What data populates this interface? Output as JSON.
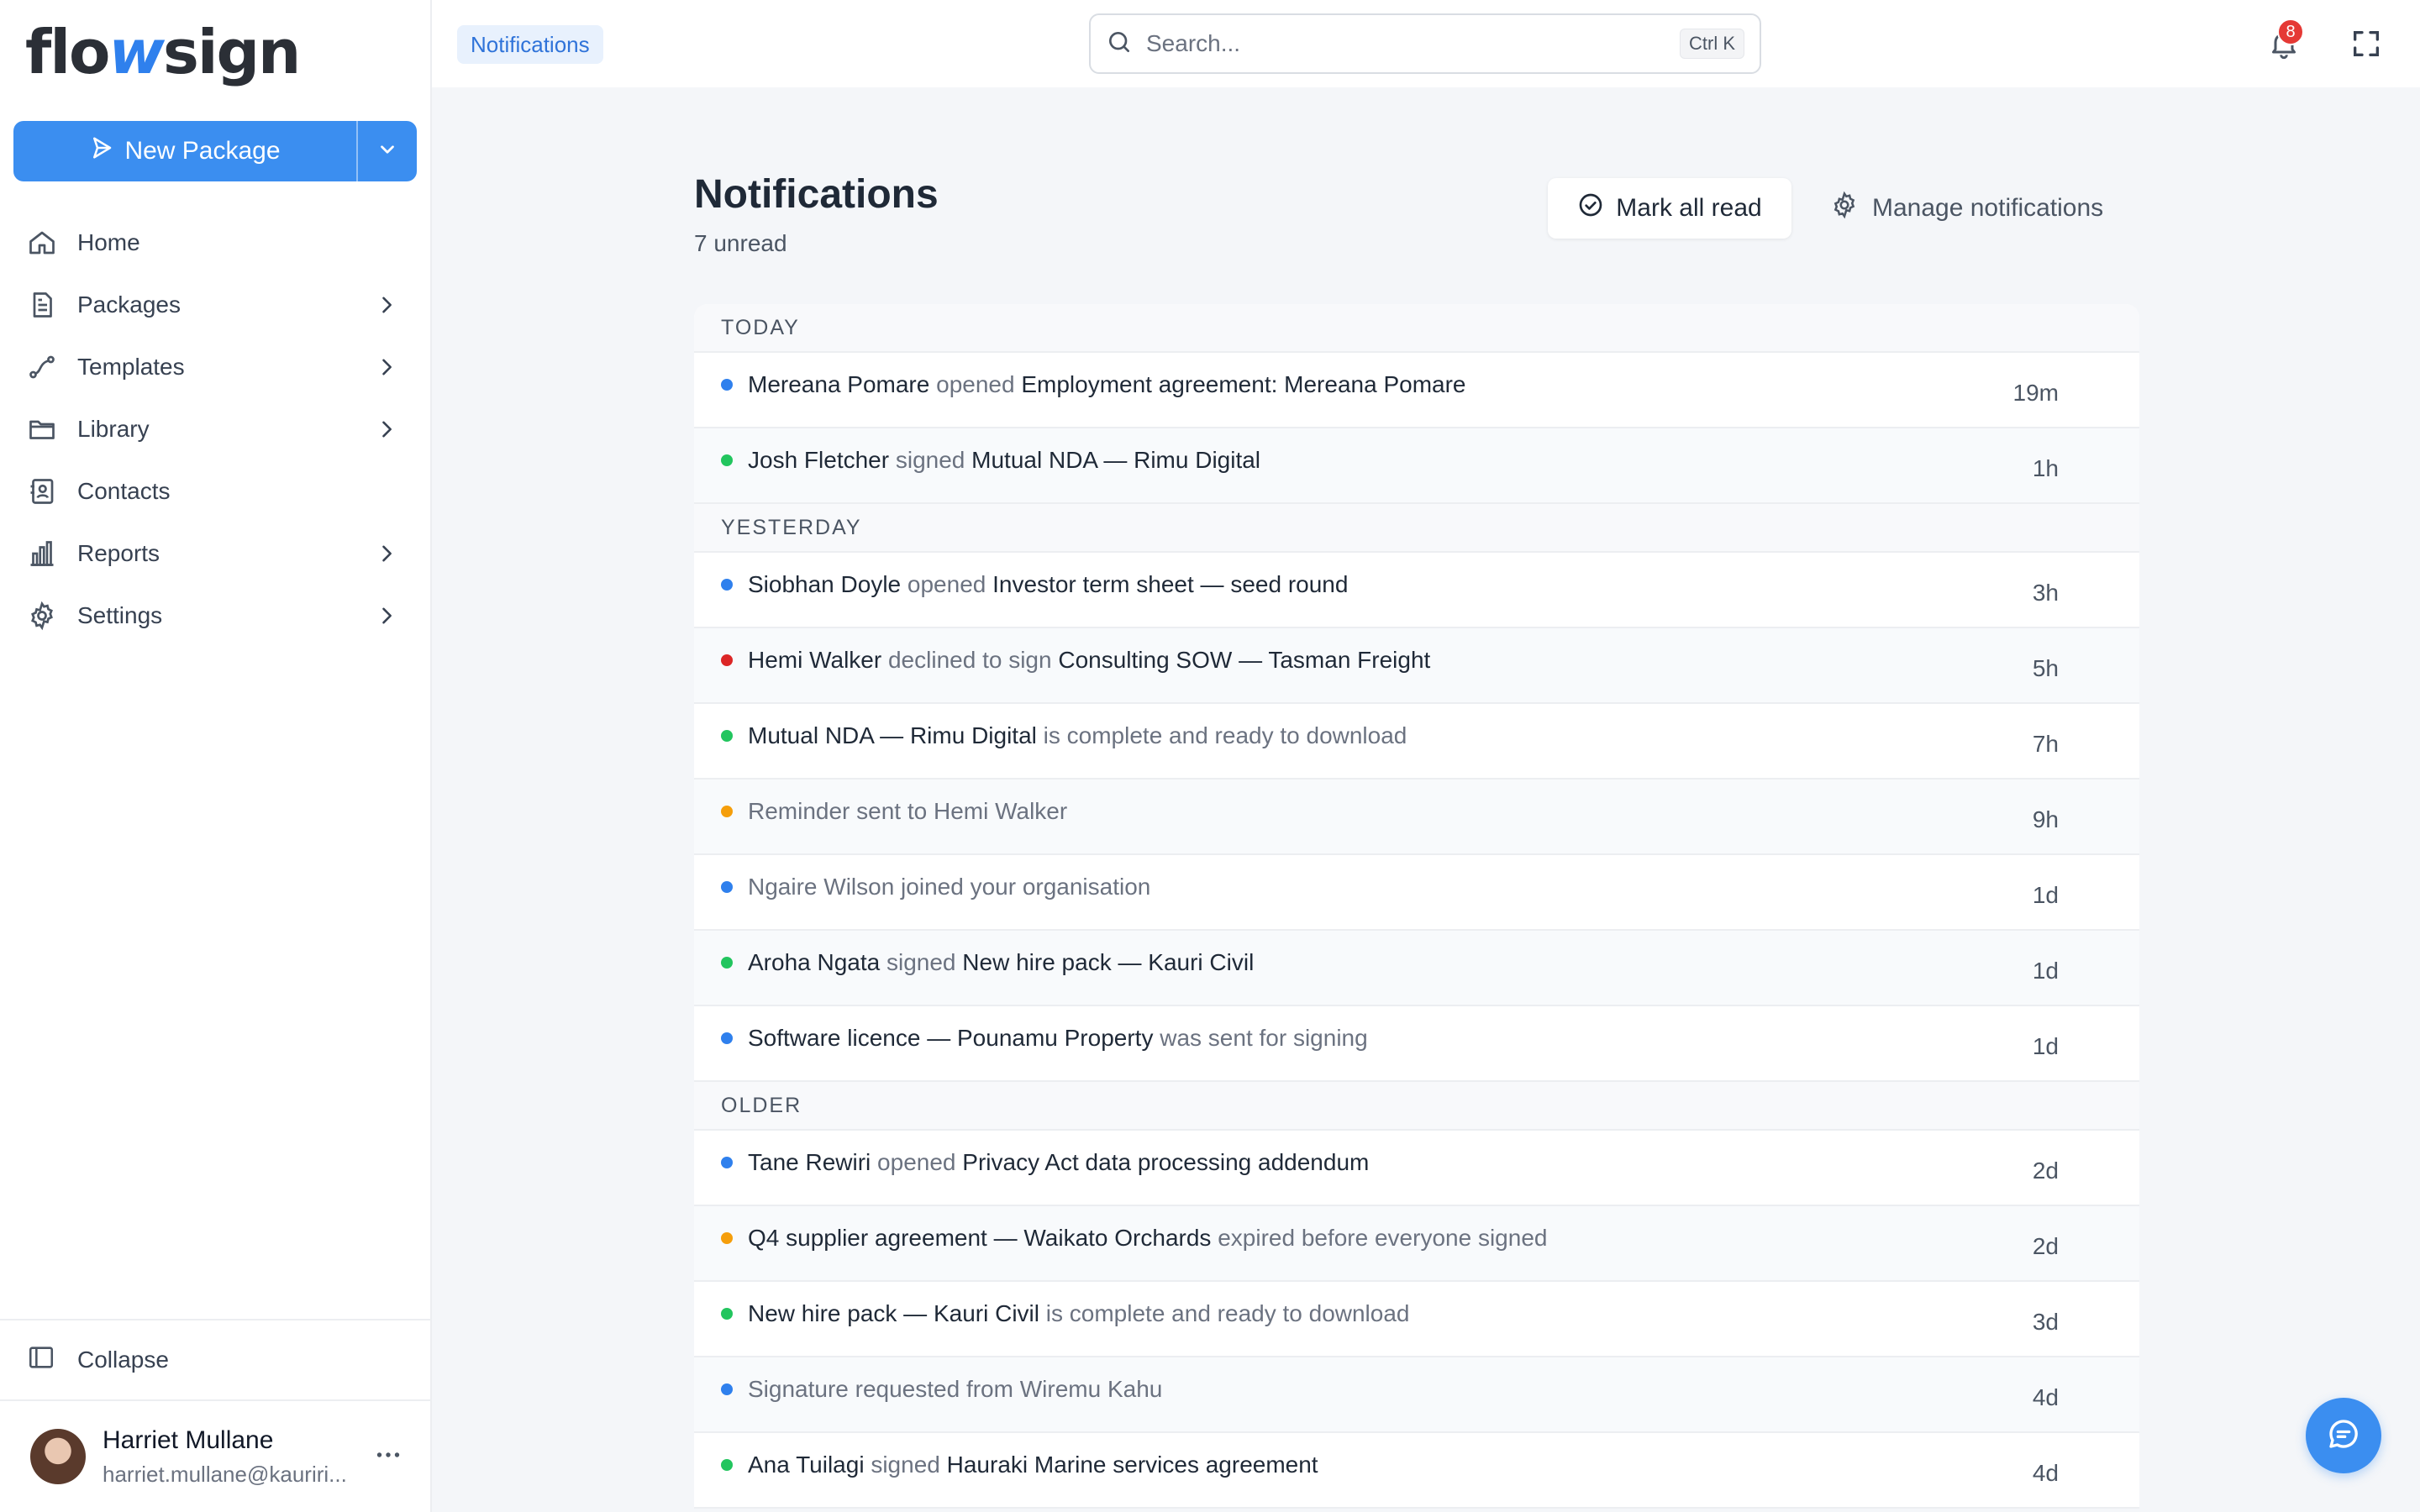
{
  "brand": {
    "logo_pre": "flo",
    "logo_accent": "w",
    "logo_post": "sign"
  },
  "sidebar": {
    "new_package_label": "New Package",
    "items": [
      {
        "label": "Home",
        "icon": "home-icon",
        "chevron": false
      },
      {
        "label": "Packages",
        "icon": "document-icon",
        "chevron": true
      },
      {
        "label": "Templates",
        "icon": "route-icon",
        "chevron": true
      },
      {
        "label": "Library",
        "icon": "folder-icon",
        "chevron": true
      },
      {
        "label": "Contacts",
        "icon": "contacts-icon",
        "chevron": false
      },
      {
        "label": "Reports",
        "icon": "bar-chart-icon",
        "chevron": true
      },
      {
        "label": "Settings",
        "icon": "gear-icon",
        "chevron": true
      }
    ],
    "collapse_label": "Collapse",
    "user": {
      "name": "Harriet Mullane",
      "email": "harriet.mullane@kauriri..."
    }
  },
  "topbar": {
    "breadcrumb": "Notifications",
    "search_placeholder": "Search...",
    "search_shortcut": "Ctrl K",
    "notification_count": "8"
  },
  "page": {
    "title": "Notifications",
    "unread_text": "7 unread",
    "mark_all_read": "Mark all read",
    "manage_notifications": "Manage notifications"
  },
  "colors": {
    "blue": "#2f80ed",
    "green": "#22c55e",
    "red": "#dc2626",
    "orange": "#f59e0b"
  },
  "groups": [
    {
      "label": "TODAY",
      "items": [
        {
          "dot": "blue",
          "parts": [
            [
              "Mereana Pomare",
              "s"
            ],
            [
              " opened ",
              "m"
            ],
            [
              "Employment agreement: Mereana Pomare",
              "s"
            ]
          ],
          "time": "19m"
        },
        {
          "dot": "green",
          "parts": [
            [
              "Josh Fletcher",
              "s"
            ],
            [
              " signed ",
              "m"
            ],
            [
              "Mutual NDA — Rimu Digital",
              "s"
            ]
          ],
          "time": "1h"
        }
      ]
    },
    {
      "label": "YESTERDAY",
      "items": [
        {
          "dot": "blue",
          "parts": [
            [
              "Siobhan Doyle",
              "s"
            ],
            [
              " opened ",
              "m"
            ],
            [
              "Investor term sheet — seed round",
              "s"
            ]
          ],
          "time": "3h"
        },
        {
          "dot": "red",
          "parts": [
            [
              "Hemi Walker",
              "s"
            ],
            [
              " declined to sign ",
              "m"
            ],
            [
              "Consulting SOW — Tasman Freight",
              "s"
            ]
          ],
          "time": "5h"
        },
        {
          "dot": "green",
          "parts": [
            [
              "Mutual NDA — Rimu Digital",
              "s"
            ],
            [
              " is complete and ready to download",
              "m"
            ]
          ],
          "time": "7h"
        },
        {
          "dot": "orange",
          "parts": [
            [
              "Reminder sent to Hemi Walker",
              "m"
            ]
          ],
          "time": "9h"
        },
        {
          "dot": "blue",
          "parts": [
            [
              "Ngaire Wilson joined your organisation",
              "m"
            ]
          ],
          "time": "1d"
        },
        {
          "dot": "green",
          "parts": [
            [
              "Aroha Ngata",
              "s"
            ],
            [
              " signed ",
              "m"
            ],
            [
              "New hire pack — Kauri Civil",
              "s"
            ]
          ],
          "time": "1d"
        },
        {
          "dot": "blue",
          "parts": [
            [
              "Software licence — Pounamu Property",
              "s"
            ],
            [
              " was sent for signing",
              "m"
            ]
          ],
          "time": "1d"
        }
      ]
    },
    {
      "label": "OLDER",
      "items": [
        {
          "dot": "blue",
          "parts": [
            [
              "Tane Rewiri",
              "s"
            ],
            [
              " opened ",
              "m"
            ],
            [
              "Privacy Act data processing addendum",
              "s"
            ]
          ],
          "time": "2d"
        },
        {
          "dot": "orange",
          "parts": [
            [
              "Q4 supplier agreement — Waikato Orchards",
              "s"
            ],
            [
              " expired before everyone signed",
              "m"
            ]
          ],
          "time": "2d"
        },
        {
          "dot": "green",
          "parts": [
            [
              "New hire pack — Kauri Civil",
              "s"
            ],
            [
              " is complete and ready to download",
              "m"
            ]
          ],
          "time": "3d"
        },
        {
          "dot": "blue",
          "parts": [
            [
              "Signature requested from Wiremu Kahu",
              "m"
            ]
          ],
          "time": "4d"
        },
        {
          "dot": "green",
          "parts": [
            [
              "Ana Tuilagi",
              "s"
            ],
            [
              " signed ",
              "m"
            ],
            [
              "Hauraki Marine services agreement",
              "s"
            ]
          ],
          "time": "4d"
        }
      ]
    }
  ]
}
